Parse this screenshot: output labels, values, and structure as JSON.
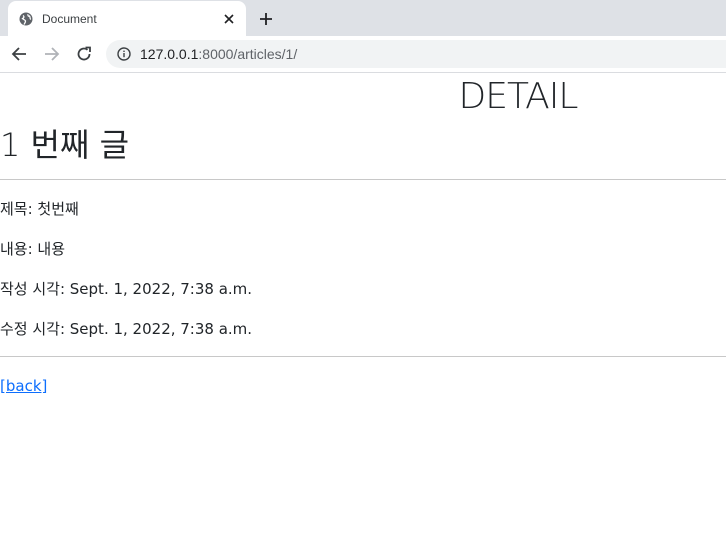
{
  "browser": {
    "tab": {
      "title": "Document",
      "favicon_icon": "globe-icon",
      "close_icon": "close-icon"
    },
    "new_tab_icon": "plus-icon",
    "nav": {
      "back_icon": "arrow-left-icon",
      "forward_icon": "arrow-right-icon",
      "reload_icon": "reload-icon"
    },
    "omnibox": {
      "info_icon": "info-icon",
      "url_host": "127.0.0.1",
      "url_rest": ":8000/articles/1/"
    }
  },
  "page": {
    "heading": "DETAIL",
    "article_title": "1 번째 글",
    "fields": [
      "제목: 첫번째",
      "내용: 내용",
      "작성 시각: Sept. 1, 2022, 7:38 a.m.",
      "수정 시각: Sept. 1, 2022, 7:38 a.m."
    ],
    "back_link": "[back]"
  },
  "colors": {
    "tabstrip_bg": "#dee1e6",
    "omnibox_bg": "#f1f3f4",
    "link": "#0d6efd",
    "text": "#212529",
    "rule": "#c8c8c8"
  }
}
